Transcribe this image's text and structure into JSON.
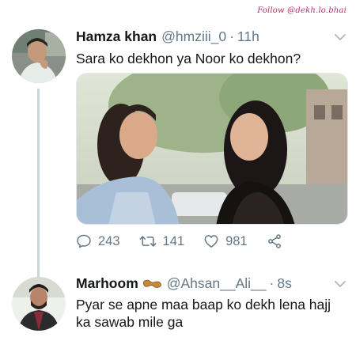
{
  "watermark": "Follow @dekh.lo.bhai",
  "tweets": [
    {
      "name": "Hamza khan",
      "handle": "@hmziii_0",
      "separator": "·",
      "time": "11h",
      "text": "Sara ko dekhon ya Noor ko dekhon?",
      "stats": {
        "replies": "243",
        "retweets": "141",
        "likes": "981"
      }
    },
    {
      "name": "Marhoom",
      "emoji": "peanut-emoji",
      "handle": "@Ahsan__Ali__",
      "separator": "·",
      "time": "8s",
      "text": "Pyar se apne maa baap ko dekh lena hajj ka sawab mile ga"
    }
  ],
  "colors": {
    "text": "#14171a",
    "muted": "#657786",
    "thread_line": "#ccd6dd"
  }
}
